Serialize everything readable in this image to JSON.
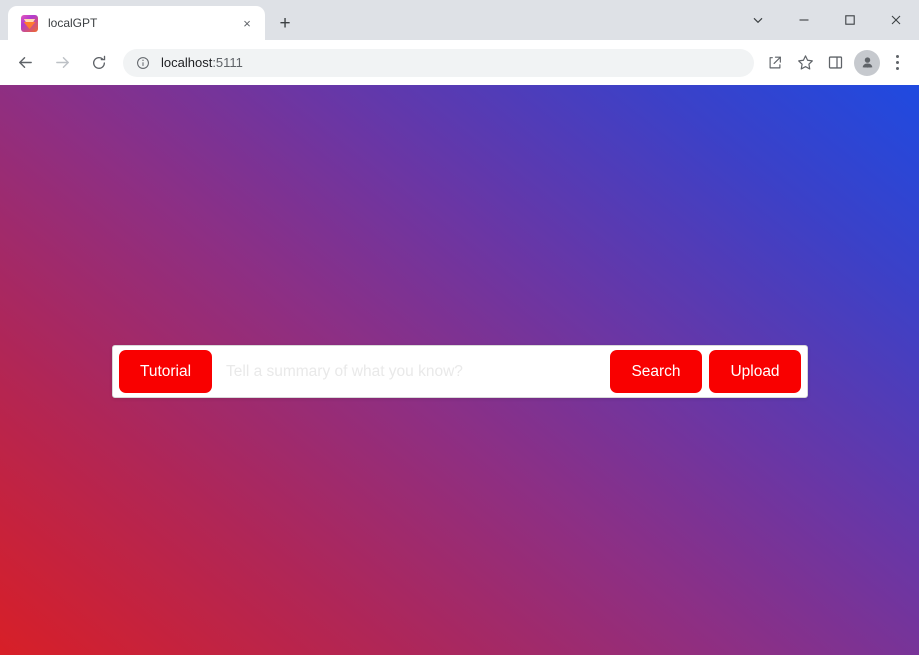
{
  "browser": {
    "tab": {
      "title": "localGPT",
      "favicon_name": "localgpt-logo-icon",
      "close_label": "×"
    },
    "new_tab_label": "+",
    "window_controls": {
      "tab_search_label": "tab-search",
      "minimize_label": "minimize",
      "maximize_label": "maximize",
      "close_label": "close"
    },
    "nav": {
      "back_label": "back",
      "forward_label": "forward",
      "reload_label": "reload"
    },
    "omnibox": {
      "host": "localhost",
      "port": ":5111",
      "info_icon": "site-information-icon"
    },
    "toolbar_icons": {
      "share": "share-icon",
      "bookmark": "star-icon",
      "side_panel": "side-panel-icon",
      "profile": "profile-avatar-icon",
      "menu": "three-dot-menu-icon"
    }
  },
  "page": {
    "background": {
      "gradient_from": "#1f4ae0",
      "gradient_mid": "#8d2f84",
      "gradient_to": "#d81f27"
    },
    "search": {
      "tutorial_label": "Tutorial",
      "placeholder": "Tell a summary of what you know?",
      "value": "",
      "search_label": "Search",
      "upload_label": "Upload",
      "accent_color": "#f90000"
    }
  }
}
